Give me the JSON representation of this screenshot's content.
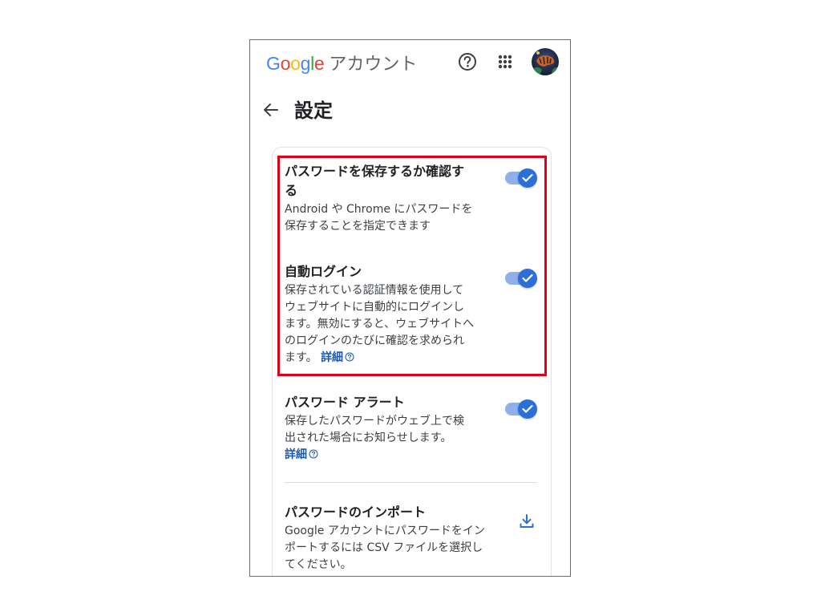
{
  "header": {
    "logo_letters": [
      {
        "char": "G",
        "color": "#4285f4"
      },
      {
        "char": "o",
        "color": "#ea4335"
      },
      {
        "char": "o",
        "color": "#fbbc05"
      },
      {
        "char": "g",
        "color": "#4285f4"
      },
      {
        "char": "l",
        "color": "#34a853"
      },
      {
        "char": "e",
        "color": "#ea4335"
      }
    ],
    "account_label": "アカウント",
    "icons": [
      "help-icon",
      "apps-grid-icon",
      "avatar"
    ]
  },
  "page": {
    "title": "設定",
    "back_icon": "arrow-left-icon"
  },
  "settings": [
    {
      "title_line1": "パスワードを保存するか確認す",
      "title_line2": "る",
      "desc_line1": "Android や Chrome にパスワードを",
      "desc_line2": "保存することを指定できます",
      "enabled": true
    },
    {
      "title": "自動ログイン",
      "desc_line1": "保存されている認証情報を使用して",
      "desc_line2": "ウェブサイトに自動的にログインし",
      "desc_line3": "ます。無効にすると、ウェブサイトへ",
      "desc_line4": "のログインのたびに確認を求められ",
      "desc_line5": "ます。",
      "learn_more": "詳細",
      "enabled": true
    },
    {
      "title": "パスワード アラート",
      "desc_line1": "保存したパスワードがウェブ上で検",
      "desc_line2": "出された場合にお知らせします。",
      "learn_more": "詳細",
      "enabled": true
    },
    {
      "title": "パスワードのインポート",
      "desc_line1": "Google アカウントにパスワードをイン",
      "desc_line2": "ポートするには CSV ファイルを選択し",
      "desc_line3": "てください。",
      "action_icon": "download-icon"
    }
  ],
  "colors": {
    "toggle_on": "#2d6fd6",
    "toggle_track": "#8fb0ea",
    "highlight_border": "#e00012",
    "link": "#1a57b0"
  }
}
